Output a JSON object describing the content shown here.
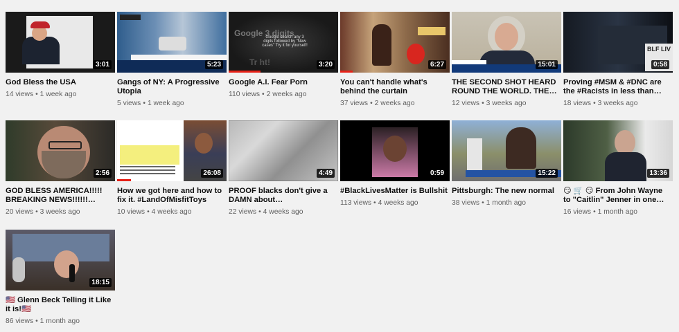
{
  "videos": [
    {
      "title": "God Bless the USA",
      "duration": "3:01",
      "views": "14 views",
      "age": "1 week ago"
    },
    {
      "title": "Gangs of NY: A Progressive Utopia",
      "duration": "5:23",
      "views": "5 views",
      "age": "1 week ago"
    },
    {
      "title": "Google A.I. Fear Porn",
      "duration": "3:20",
      "views": "110 views",
      "age": "2 weeks ago"
    },
    {
      "title": "You can't handle what's behind the curtain",
      "duration": "6:27",
      "views": "37 views",
      "age": "2 weeks ago"
    },
    {
      "title": "THE SECOND SHOT HEARD ROUND THE WORLD. THE…",
      "duration": "15:01",
      "views": "12 views",
      "age": "3 weeks ago"
    },
    {
      "title": "Proving #MSM & #DNC are the #Racists in less than on…",
      "duration": "0:58",
      "views": "18 views",
      "age": "3 weeks ago"
    },
    {
      "title": "GOD BLESS AMERICA!!!!! BREAKING NEWS!!!!!!…",
      "duration": "2:56",
      "views": "20 views",
      "age": "3 weeks ago"
    },
    {
      "title": "How we got here and how to fix it. #LandOfMisfitToys",
      "duration": "26:08",
      "views": "10 views",
      "age": "4 weeks ago"
    },
    {
      "title": "PROOF blacks don't give a DAMN about…",
      "duration": "4:49",
      "views": "22 views",
      "age": "4 weeks ago"
    },
    {
      "title": "#BlackLivesMatter is Bullshit",
      "duration": "0:59",
      "views": "113 views",
      "age": "4 weeks ago"
    },
    {
      "title": "Pittsburgh: The new normal",
      "duration": "15:22",
      "views": "38 views",
      "age": "1 month ago"
    },
    {
      "title": "😏 🛒 😏 From John Wayne to \"Caitlin\" Jenner in one…",
      "duration": "13:36",
      "views": "16 views",
      "age": "1 month ago"
    },
    {
      "title": "🇺🇸 Glenn Beck Telling it Like it is!🇺🇸",
      "duration": "18:15",
      "views": "86 views",
      "age": "1 month ago"
    }
  ],
  "separator": "•",
  "thumb_texts": {
    "google_big": "Google 3 digits",
    "google_small": "Google search any 3 digits followed by \"New cases\" Try it for yourself!",
    "google_bottom": "Tr        ht!",
    "blf": "BLF LIV"
  },
  "colors": {
    "progress": "#e62117",
    "background": "#f1f1f1"
  }
}
